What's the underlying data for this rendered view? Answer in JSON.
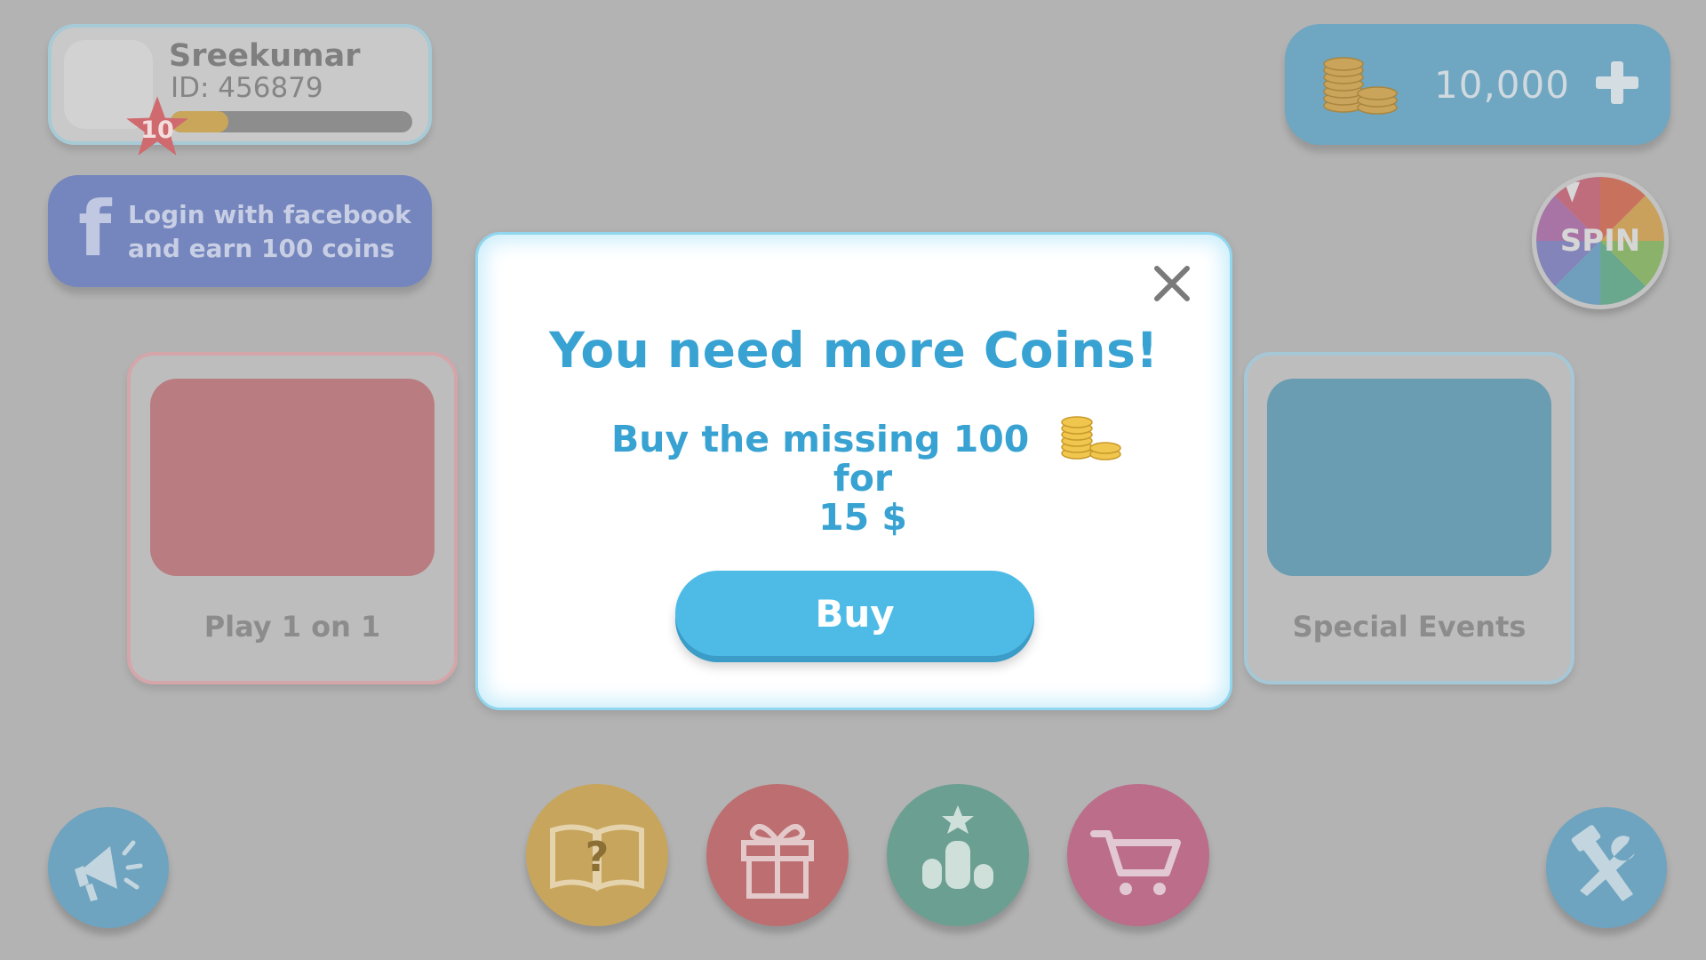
{
  "profile": {
    "name": "Sreekumar",
    "id_text": "ID: 456879",
    "level": "10",
    "xp_progress": 0.24
  },
  "facebook": {
    "label": "Login with facebook\nand earn 100 coins",
    "icon": "facebook-icon"
  },
  "coins": {
    "value": "10,000",
    "icon": "coin-stack-icon",
    "add_icon": "plus-icon"
  },
  "spin": {
    "label": "SPIN"
  },
  "modes": [
    {
      "label": "Play 1 on 1"
    },
    {
      "label": "Special Events"
    }
  ],
  "bottom_buttons": [
    {
      "name": "help-book-icon"
    },
    {
      "name": "gift-icon"
    },
    {
      "name": "leaderboard-icon"
    },
    {
      "name": "cart-icon"
    },
    {
      "name": "megaphone-icon"
    },
    {
      "name": "tools-icon"
    }
  ],
  "modal": {
    "title": "You need more Coins!",
    "line1": "Buy the missing 100",
    "line2": "for",
    "line3": "15 $",
    "buy_label": "Buy",
    "close_icon": "close-icon"
  },
  "colors": {
    "accent": "#38a2d2",
    "buy_button": "#4dbbe6",
    "background": "#b3b3b3"
  }
}
